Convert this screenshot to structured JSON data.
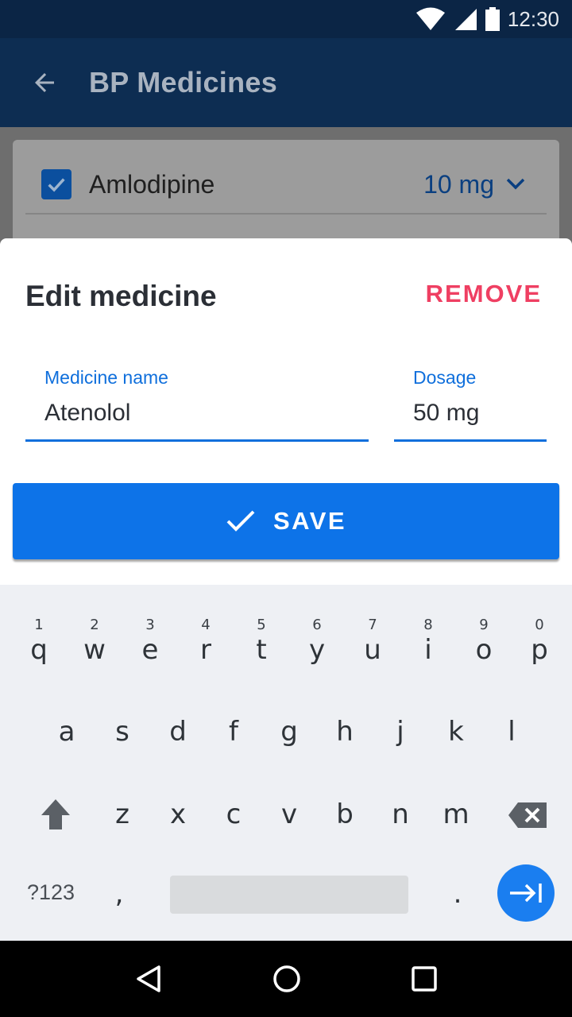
{
  "status_bar": {
    "time": "12:30",
    "icons": [
      "wifi-icon",
      "signal-icon",
      "battery-icon"
    ]
  },
  "toolbar": {
    "title": "BP Medicines",
    "back_icon": "arrow-back-icon"
  },
  "background_list": {
    "items": [
      {
        "name": "Amlodipine",
        "dosage": "10 mg",
        "checked": true
      }
    ]
  },
  "sheet": {
    "title": "Edit medicine",
    "remove_label": "REMOVE",
    "name_field": {
      "label": "Medicine name",
      "value": "Atenolol"
    },
    "dosage_field": {
      "label": "Dosage",
      "value": "50 mg"
    },
    "save_label": "SAVE"
  },
  "keyboard": {
    "row1": [
      {
        "hint": "1",
        "key": "q"
      },
      {
        "hint": "2",
        "key": "w"
      },
      {
        "hint": "3",
        "key": "e"
      },
      {
        "hint": "4",
        "key": "r"
      },
      {
        "hint": "5",
        "key": "t"
      },
      {
        "hint": "6",
        "key": "y"
      },
      {
        "hint": "7",
        "key": "u"
      },
      {
        "hint": "8",
        "key": "i"
      },
      {
        "hint": "9",
        "key": "o"
      },
      {
        "hint": "0",
        "key": "p"
      }
    ],
    "row2": [
      "a",
      "s",
      "d",
      "f",
      "g",
      "h",
      "j",
      "k",
      "l"
    ],
    "row3": [
      "z",
      "x",
      "c",
      "v",
      "b",
      "n",
      "m"
    ],
    "symbols_label": "?123",
    "comma": ",",
    "period": "."
  },
  "colors": {
    "primary": "#0d73e8",
    "danger": "#ef3f62",
    "toolbar": "#0d2d52",
    "status_bar": "#0b2545"
  }
}
